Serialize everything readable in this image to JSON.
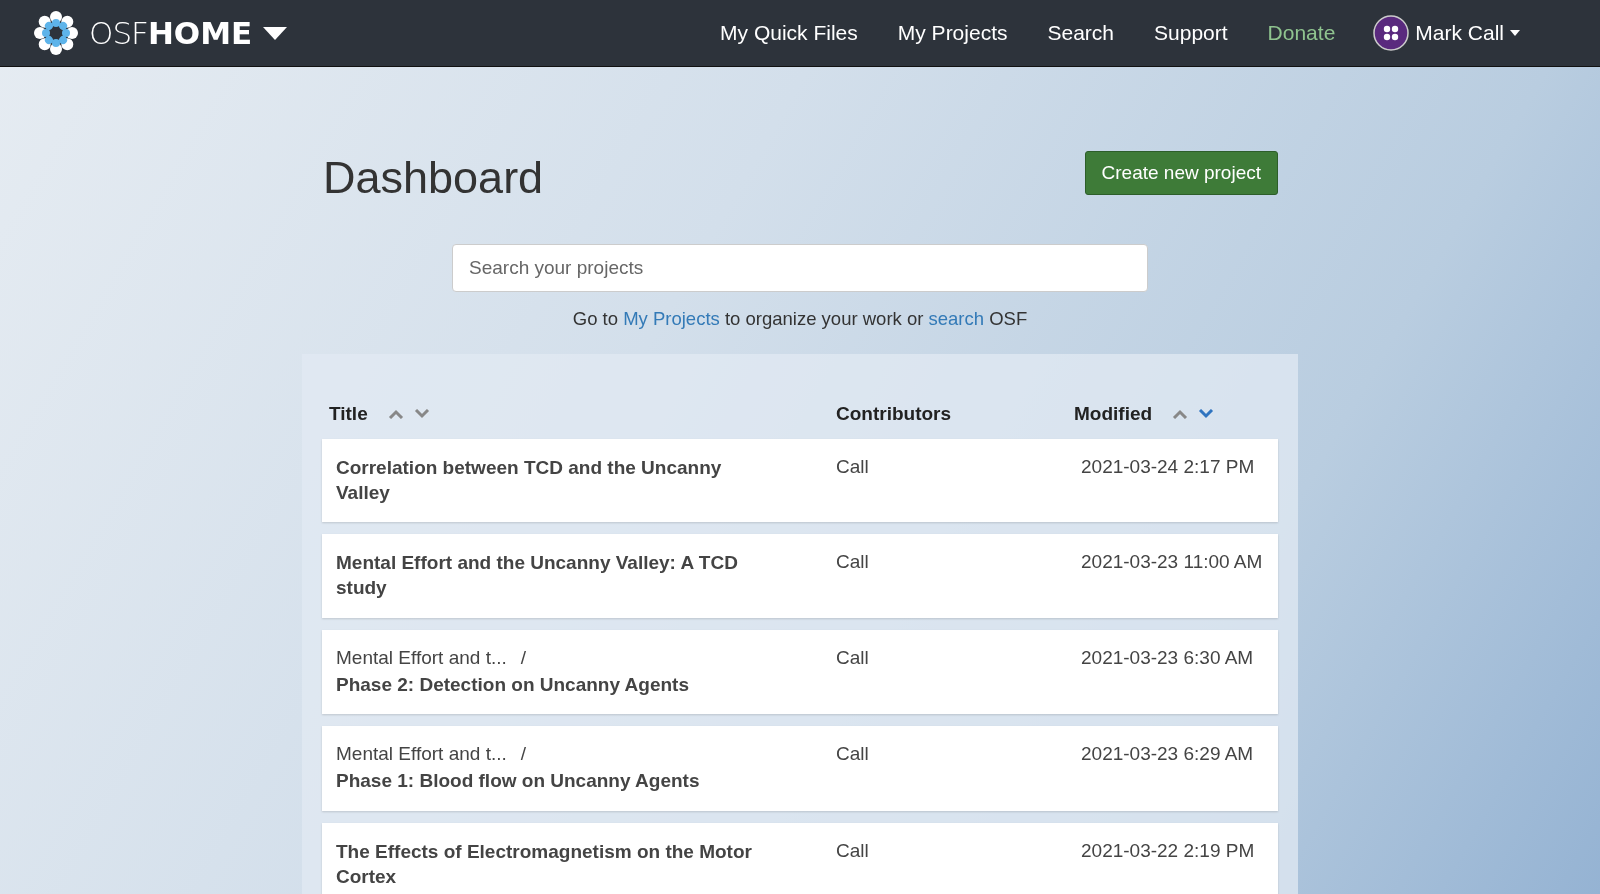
{
  "navbar": {
    "brand_light": "OSF",
    "brand_bold": "HOME",
    "links": [
      {
        "label": "My Quick Files",
        "kind": "normal"
      },
      {
        "label": "My Projects",
        "kind": "normal"
      },
      {
        "label": "Search",
        "kind": "normal"
      },
      {
        "label": "Support",
        "kind": "normal"
      },
      {
        "label": "Donate",
        "kind": "donate"
      }
    ],
    "user": "Mark Call"
  },
  "page": {
    "title": "Dashboard",
    "create_button": "Create new project",
    "search": {
      "placeholder": "Search your projects"
    },
    "hint": {
      "before": "Go to",
      "link1": "My Projects",
      "middle": "to organize your work or",
      "link2": "search",
      "after": "OSF"
    }
  },
  "table": {
    "columns": [
      {
        "label": "Title",
        "sort_ascending_selected": false,
        "sort_descending_selected": false
      },
      {
        "label": "Contributors"
      },
      {
        "label": "Modified",
        "sort_ascending_selected": false,
        "sort_descending_selected": true
      }
    ],
    "rows": [
      {
        "title": "Correlation between TCD and the Uncanny Valley",
        "contributors": "Call",
        "modified": "2021-03-24 2:17 PM"
      },
      {
        "title": "Mental Effort and the Uncanny Valley: A TCD study",
        "contributors": "Call",
        "modified": "2021-03-23 11:00 AM"
      },
      {
        "parent": "Mental Effort and t...",
        "separator": "/",
        "title": "Phase 2: Detection on Uncanny Agents",
        "contributors": "Call",
        "modified": "2021-03-23 6:30 AM"
      },
      {
        "parent": "Mental Effort and t...",
        "separator": "/",
        "title": "Phase 1: Blood flow on Uncanny Agents",
        "contributors": "Call",
        "modified": "2021-03-23 6:29 AM"
      },
      {
        "title": "The Effects of Electromagnetism on the Motor Cortex",
        "contributors": "Call",
        "modified": "2021-03-22 2:19 PM"
      }
    ]
  }
}
